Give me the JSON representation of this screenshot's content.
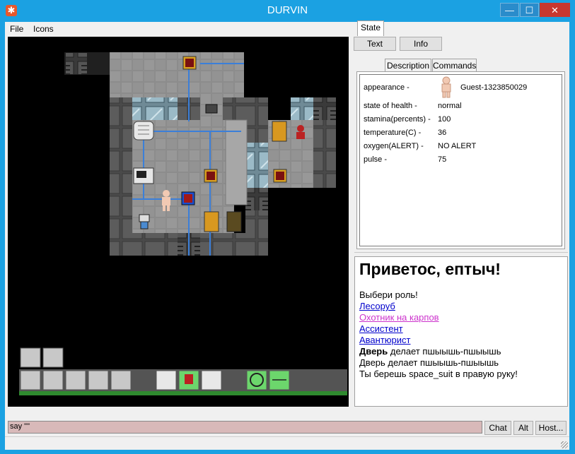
{
  "window": {
    "title": "DURVIN"
  },
  "menu": {
    "file": "File",
    "icons": "Icons"
  },
  "panel_buttons": {
    "text": "Text",
    "info": "Info"
  },
  "tabs": [
    "State",
    "Description",
    "Commands"
  ],
  "state": {
    "rows": [
      {
        "label": "appearance -",
        "value": "Guest-1323850029"
      },
      {
        "label": "state of health -",
        "value": "normal"
      },
      {
        "label": "stamina(percents) -",
        "value": "100"
      },
      {
        "label": "temperature(C) -",
        "value": "36"
      },
      {
        "label": "oxygen(ALERT) -",
        "value": "NO ALERT"
      },
      {
        "label": "pulse -",
        "value": "75"
      }
    ]
  },
  "chat": {
    "greeting": "Приветос, ептыч!",
    "choose_role": "Выбери роль!",
    "roles": [
      "Лесоруб",
      "Охотник на карпов",
      "Ассистент",
      "Авантюрист"
    ],
    "door_bold": "Дверь",
    "door_rest": " делает пшыышь-пшыышь",
    "door_line2": "Дверь делает пшыышь-пшыышь",
    "suit_line": "Ты берешь space_suit в правую руку!"
  },
  "input": {
    "value": "say \"\""
  },
  "bottom_buttons": {
    "chat": "Chat",
    "alt": "Alt",
    "host": "Host..."
  },
  "colors": {
    "titlebar": "#1ba1e2",
    "close": "#c7372f",
    "input_bg": "#d8b9b9",
    "link": "#0000cc",
    "visited": "#cc33cc",
    "floor": "#8c8c8c",
    "wall": "#555555",
    "pipe": "#3b7fd9"
  }
}
